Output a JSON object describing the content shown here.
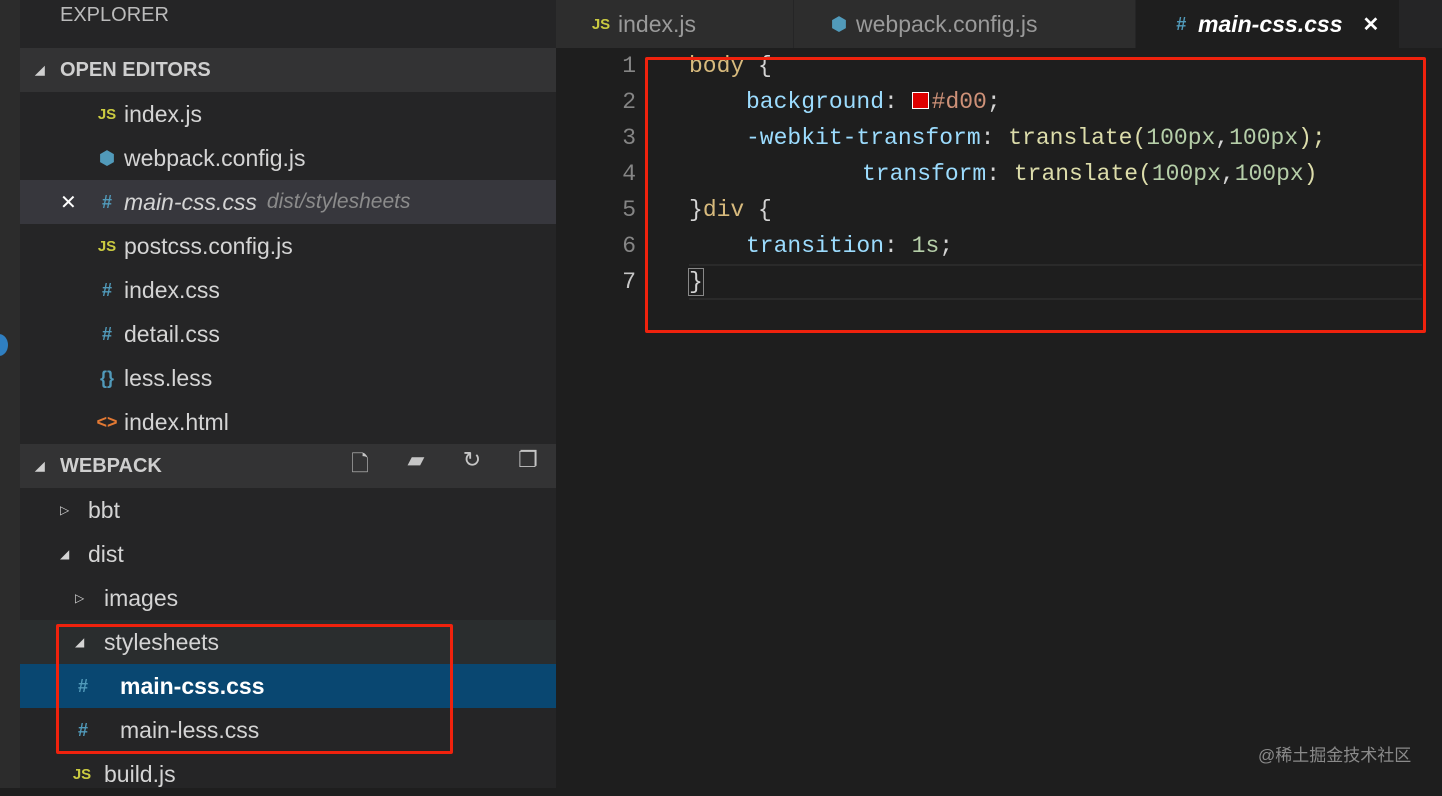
{
  "sidebar": {
    "title": "EXPLORER",
    "open_editors": {
      "label": "OPEN EDITORS",
      "items": [
        {
          "name": "index.js",
          "icon": "js-icon"
        },
        {
          "name": "webpack.config.js",
          "icon": "webpack-icon"
        },
        {
          "name": "main-css.css",
          "icon": "css-icon",
          "desc": "dist/stylesheets",
          "close": "✕"
        },
        {
          "name": "postcss.config.js",
          "icon": "js-icon"
        },
        {
          "name": "index.css",
          "icon": "css-icon"
        },
        {
          "name": "detail.css",
          "icon": "css-icon"
        },
        {
          "name": "less.less",
          "icon": "less-icon"
        },
        {
          "name": "index.html",
          "icon": "html-icon"
        }
      ]
    },
    "project": {
      "label": "WEBPACK",
      "tree": [
        {
          "name": "bbt"
        },
        {
          "name": "dist"
        },
        {
          "name": "images"
        },
        {
          "name": "stylesheets"
        },
        {
          "name": "main-css.css"
        },
        {
          "name": "main-less.css"
        },
        {
          "name": "build.js"
        }
      ]
    }
  },
  "tabs": [
    {
      "label": "index.js"
    },
    {
      "label": "webpack.config.js"
    },
    {
      "label": "main-css.css",
      "close": "✕"
    }
  ],
  "editor": {
    "line_numbers": [
      "1",
      "2",
      "3",
      "4",
      "5",
      "6",
      "7"
    ],
    "l1": {
      "sel": "body",
      "rest": " {"
    },
    "l2": {
      "prop": "background",
      "colon": ": ",
      "hex": "#d00",
      "end": ";"
    },
    "l3": {
      "prop": "-webkit-transform",
      "colon": ": ",
      "fn": "translate(",
      "a": "100px",
      "c": ",",
      "b": "100px",
      "end": ");"
    },
    "l4": {
      "prop": "transform",
      "colon": ": ",
      "fn": "translate(",
      "a": "100px",
      "c": ",",
      "b": "100px",
      "end": ")"
    },
    "l5": {
      "pre": "}",
      "sel": "div",
      "rest": " {"
    },
    "l6": {
      "prop": "transition",
      "colon": ": ",
      "num": "1s",
      "end": ";"
    },
    "l7": {
      "text": "}"
    }
  },
  "colors": {
    "swatch": "#dd0000",
    "highlight": "#f0220d"
  },
  "watermark": "@稀土掘金技术社区"
}
